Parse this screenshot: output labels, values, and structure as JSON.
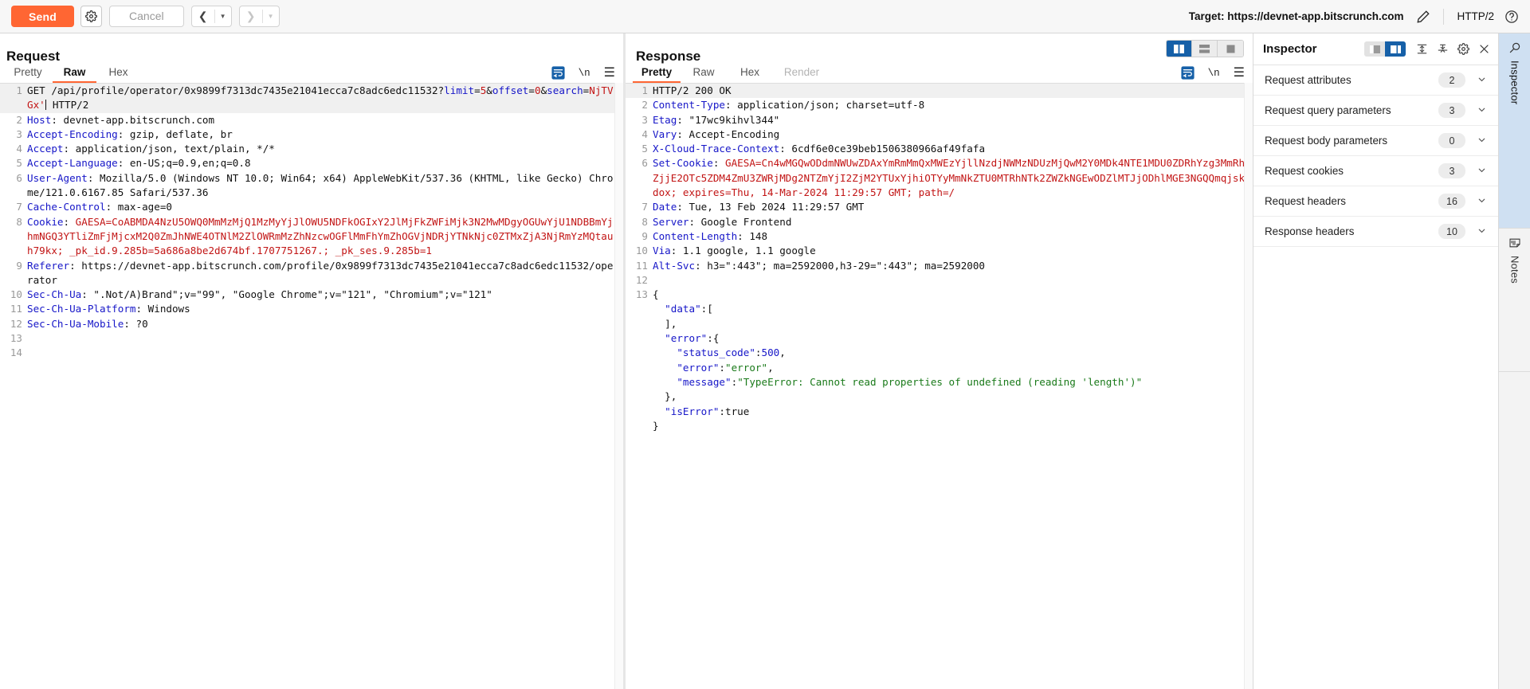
{
  "toolbar": {
    "send_label": "Send",
    "gear_icon": "gear-icon",
    "cancel_label": "Cancel",
    "back_icon": "chevron-left-icon",
    "forward_icon": "chevron-right-icon",
    "target_label": "Target: https://devnet-app.bitscrunch.com",
    "edit_icon": "pencil-icon",
    "protocol": "HTTP/2",
    "help_icon": "help-circle-icon"
  },
  "request": {
    "title": "Request",
    "tabs": [
      {
        "label": "Pretty",
        "active": false,
        "disabled": false
      },
      {
        "label": "Raw",
        "active": true,
        "disabled": false
      },
      {
        "label": "Hex",
        "active": false,
        "disabled": false
      }
    ],
    "tools": {
      "wrap_icon": "word-wrap-icon",
      "newline_label": "\\n",
      "menu_icon": "hamburger-menu-icon"
    },
    "lines": [
      {
        "num": "1",
        "highlight": true,
        "parts": [
          {
            "t": "GET /api/profile/operator/0x9899f7313dc7435e21041ecca7c8adc6edc11532?",
            "c": "k-plain"
          },
          {
            "t": "limit",
            "c": "k-blue"
          },
          {
            "t": "=",
            "c": "k-plain"
          },
          {
            "t": "5",
            "c": "k-red"
          },
          {
            "t": "&",
            "c": "k-plain"
          },
          {
            "t": "offset",
            "c": "k-blue"
          },
          {
            "t": "=",
            "c": "k-plain"
          },
          {
            "t": "0",
            "c": "k-red"
          },
          {
            "t": "&",
            "c": "k-plain"
          },
          {
            "t": "search",
            "c": "k-blue"
          },
          {
            "t": "=",
            "c": "k-plain"
          },
          {
            "t": "NjTVGx'",
            "c": "k-red"
          },
          {
            "t": "CARET",
            "c": "caret"
          },
          {
            "t": " HTTP/2",
            "c": "k-plain"
          }
        ]
      },
      {
        "num": "2",
        "parts": [
          {
            "t": "Host",
            "c": "k-hdr"
          },
          {
            "t": ": devnet-app.bitscrunch.com",
            "c": "k-plain"
          }
        ]
      },
      {
        "num": "3",
        "parts": [
          {
            "t": "Accept-Encoding",
            "c": "k-hdr"
          },
          {
            "t": ": gzip, deflate, br",
            "c": "k-plain"
          }
        ]
      },
      {
        "num": "4",
        "parts": [
          {
            "t": "Accept",
            "c": "k-hdr"
          },
          {
            "t": ": application/json, text/plain, */*",
            "c": "k-plain"
          }
        ]
      },
      {
        "num": "5",
        "parts": [
          {
            "t": "Accept-Language",
            "c": "k-hdr"
          },
          {
            "t": ": en-US;q=0.9,en;q=0.8",
            "c": "k-plain"
          }
        ]
      },
      {
        "num": "6",
        "parts": [
          {
            "t": "User-Agent",
            "c": "k-hdr"
          },
          {
            "t": ": Mozilla/5.0 (Windows NT 10.0; Win64; x64) AppleWebKit/537.36 (KHTML, like Gecko) Chrome/121.0.6167.85 Safari/537.36",
            "c": "k-plain"
          }
        ]
      },
      {
        "num": "7",
        "parts": [
          {
            "t": "Cache-Control",
            "c": "k-hdr"
          },
          {
            "t": ": max-age=0",
            "c": "k-plain"
          }
        ]
      },
      {
        "num": "8",
        "parts": [
          {
            "t": "Cookie",
            "c": "k-hdr"
          },
          {
            "t": ": ",
            "c": "k-plain"
          },
          {
            "t": "GAESA=CoABMDA4NzU5OWQ0MmMzMjQ1MzMyYjJlOWU5NDFkOGIxY2JlMjFkZWFiMjk3N2MwMDgyOGUwYjU1NDBBmYjhmNGQ3YTliZmFjMjcxM2Q0ZmJhNWE4OTNlM2ZlOWRmMzZhNzcwOGFlMmFhYmZhOGVjNDRjYTNkNjc0ZTMxZjA3NjRmYzMQtauh79kx; _pk_id.9.285b=5a686a8be2d674bf.1707751267.; _pk_ses.9.285b=1",
            "c": "k-red"
          }
        ]
      },
      {
        "num": "9",
        "parts": [
          {
            "t": "Referer",
            "c": "k-hdr"
          },
          {
            "t": ": https://devnet-app.bitscrunch.com/profile/0x9899f7313dc7435e21041ecca7c8adc6edc11532/operator",
            "c": "k-plain"
          }
        ]
      },
      {
        "num": "10",
        "parts": [
          {
            "t": "Sec-Ch-Ua",
            "c": "k-hdr"
          },
          {
            "t": ": \".Not/A)Brand\";v=\"99\", \"Google Chrome\";v=\"121\", \"Chromium\";v=\"121\"",
            "c": "k-plain"
          }
        ]
      },
      {
        "num": "11",
        "parts": [
          {
            "t": "Sec-Ch-Ua-Platform",
            "c": "k-hdr"
          },
          {
            "t": ": Windows",
            "c": "k-plain"
          }
        ]
      },
      {
        "num": "12",
        "parts": [
          {
            "t": "Sec-Ch-Ua-Mobile",
            "c": "k-hdr"
          },
          {
            "t": ": ?0",
            "c": "k-plain"
          }
        ]
      },
      {
        "num": "13",
        "parts": [
          {
            "t": "",
            "c": "k-plain"
          }
        ]
      },
      {
        "num": "14",
        "parts": [
          {
            "t": "",
            "c": "k-plain"
          }
        ]
      }
    ]
  },
  "response": {
    "title": "Response",
    "view_toggle": [
      {
        "icon": "split-vertical-icon",
        "active": true
      },
      {
        "icon": "split-horizontal-icon",
        "active": false
      },
      {
        "icon": "single-pane-icon",
        "active": false
      }
    ],
    "tabs": [
      {
        "label": "Pretty",
        "active": true,
        "disabled": false
      },
      {
        "label": "Raw",
        "active": false,
        "disabled": false
      },
      {
        "label": "Hex",
        "active": false,
        "disabled": false
      },
      {
        "label": "Render",
        "active": false,
        "disabled": true
      }
    ],
    "tools": {
      "wrap_icon": "word-wrap-icon",
      "newline_label": "\\n",
      "menu_icon": "hamburger-menu-icon"
    },
    "lines": [
      {
        "num": "1",
        "highlight": true,
        "parts": [
          {
            "t": "HTTP/2 200 OK",
            "c": "k-plain"
          }
        ]
      },
      {
        "num": "2",
        "parts": [
          {
            "t": "Content-Type",
            "c": "k-hdr"
          },
          {
            "t": ": application/json; charset=utf-8",
            "c": "k-plain"
          }
        ]
      },
      {
        "num": "3",
        "parts": [
          {
            "t": "Etag",
            "c": "k-hdr"
          },
          {
            "t": ": \"17wc9kihvl344\"",
            "c": "k-plain"
          }
        ]
      },
      {
        "num": "4",
        "parts": [
          {
            "t": "Vary",
            "c": "k-hdr"
          },
          {
            "t": ": Accept-Encoding",
            "c": "k-plain"
          }
        ]
      },
      {
        "num": "5",
        "parts": [
          {
            "t": "X-Cloud-Trace-Context",
            "c": "k-hdr"
          },
          {
            "t": ": 6cdf6e0ce39beb1506380966af49fafa",
            "c": "k-plain"
          }
        ]
      },
      {
        "num": "6",
        "parts": [
          {
            "t": "Set-Cookie",
            "c": "k-hdr"
          },
          {
            "t": ": ",
            "c": "k-plain"
          },
          {
            "t": "GAESA=Cn4wMGQwODdmNWUwZDAxYmRmMmQxMWEzYjllNzdjNWMzNDUzMjQwM2Y0MDk4NTE1MDU0ZDRhYzg3MmRhZjjE2OTc5ZDM4ZmU3ZWRjMDg2NTZmYjI2ZjM2YTUxYjhiOTYyMmNkZTU0MTRhNTk2ZWZkNGEwODZlMTJjODhlMGE3NGQQmqjskdox; expires=Thu, 14-Mar-2024 11:29:57 GMT; path=/",
            "c": "k-red"
          }
        ]
      },
      {
        "num": "7",
        "parts": [
          {
            "t": "Date",
            "c": "k-hdr"
          },
          {
            "t": ": Tue, 13 Feb 2024 11:29:57 GMT",
            "c": "k-plain"
          }
        ]
      },
      {
        "num": "8",
        "parts": [
          {
            "t": "Server",
            "c": "k-hdr"
          },
          {
            "t": ": Google Frontend",
            "c": "k-plain"
          }
        ]
      },
      {
        "num": "9",
        "parts": [
          {
            "t": "Content-Length",
            "c": "k-hdr"
          },
          {
            "t": ": 148",
            "c": "k-plain"
          }
        ]
      },
      {
        "num": "10",
        "parts": [
          {
            "t": "Via",
            "c": "k-hdr"
          },
          {
            "t": ": 1.1 google, 1.1 google",
            "c": "k-plain"
          }
        ]
      },
      {
        "num": "11",
        "parts": [
          {
            "t": "Alt-Svc",
            "c": "k-hdr"
          },
          {
            "t": ": h3=\":443\"; ma=2592000,h3-29=\":443\"; ma=2592000",
            "c": "k-plain"
          }
        ]
      },
      {
        "num": "12",
        "parts": [
          {
            "t": "",
            "c": "k-plain"
          }
        ]
      },
      {
        "num": "13",
        "parts": [
          {
            "t": "{",
            "c": "k-plain"
          }
        ]
      },
      {
        "num": "",
        "parts": [
          {
            "t": "  \"data\"",
            "c": "k-blue"
          },
          {
            "t": ":[",
            "c": "k-plain"
          }
        ]
      },
      {
        "num": "",
        "parts": [
          {
            "t": "  ],",
            "c": "k-plain"
          }
        ]
      },
      {
        "num": "",
        "parts": [
          {
            "t": "  \"error\"",
            "c": "k-blue"
          },
          {
            "t": ":{",
            "c": "k-plain"
          }
        ]
      },
      {
        "num": "",
        "parts": [
          {
            "t": "    \"status_code\"",
            "c": "k-blue"
          },
          {
            "t": ":",
            "c": "k-plain"
          },
          {
            "t": "500",
            "c": "k-blue"
          },
          {
            "t": ",",
            "c": "k-plain"
          }
        ]
      },
      {
        "num": "",
        "parts": [
          {
            "t": "    \"error\"",
            "c": "k-blue"
          },
          {
            "t": ":",
            "c": "k-plain"
          },
          {
            "t": "\"error\"",
            "c": "k-green"
          },
          {
            "t": ",",
            "c": "k-plain"
          }
        ]
      },
      {
        "num": "",
        "parts": [
          {
            "t": "    \"message\"",
            "c": "k-blue"
          },
          {
            "t": ":",
            "c": "k-plain"
          },
          {
            "t": "\"TypeError: Cannot read properties of undefined (reading 'length')\"",
            "c": "k-green"
          }
        ]
      },
      {
        "num": "",
        "parts": [
          {
            "t": "  },",
            "c": "k-plain"
          }
        ]
      },
      {
        "num": "",
        "parts": [
          {
            "t": "  \"isError\"",
            "c": "k-blue"
          },
          {
            "t": ":true",
            "c": "k-plain"
          }
        ]
      },
      {
        "num": "",
        "parts": [
          {
            "t": "}",
            "c": "k-plain"
          }
        ]
      }
    ]
  },
  "inspector": {
    "title": "Inspector",
    "seg_toggle": [
      {
        "icon": "layout-left-icon",
        "active": false
      },
      {
        "icon": "layout-right-icon",
        "active": true
      }
    ],
    "expand_all_icon": "expand-all-icon",
    "collapse_all_icon": "collapse-all-icon",
    "settings_icon": "gear-icon",
    "close_icon": "close-icon",
    "sections": [
      {
        "label": "Request attributes",
        "count": "2"
      },
      {
        "label": "Request query parameters",
        "count": "3"
      },
      {
        "label": "Request body parameters",
        "count": "0"
      },
      {
        "label": "Request cookies",
        "count": "3"
      },
      {
        "label": "Request headers",
        "count": "16"
      },
      {
        "label": "Response headers",
        "count": "10"
      }
    ]
  },
  "rail": {
    "tabs": [
      {
        "label": "Inspector",
        "icon": "inspector-icon",
        "active": true
      },
      {
        "label": "Notes",
        "icon": "notes-icon",
        "active": false
      }
    ]
  },
  "colors": {
    "accent_orange": "#ff6633",
    "accent_blue": "#1660a8",
    "header_blue": "#1616c8",
    "value_red": "#c21515",
    "string_green": "#1a7a1a"
  }
}
